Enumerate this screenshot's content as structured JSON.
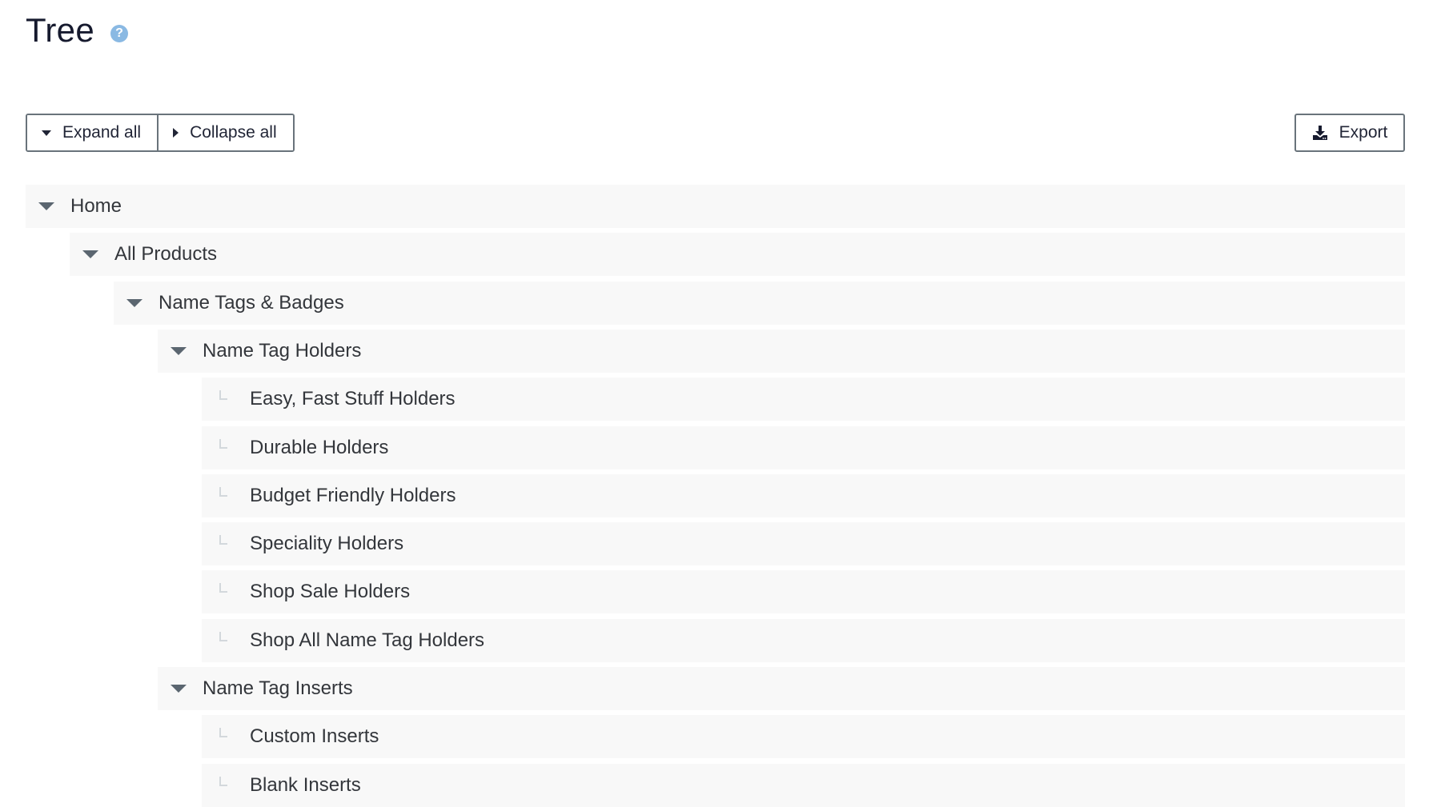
{
  "page": {
    "title": "Tree",
    "help_icon": "question-circle-icon"
  },
  "toolbar": {
    "expand_all_label": "Expand all",
    "collapse_all_label": "Collapse all",
    "export_label": "Export",
    "export_icon": "download-icon"
  },
  "colors": {
    "title": "#161a2e",
    "help_icon": "#8ab9e3",
    "button_border": "#69737b",
    "row_background": "#f8f8f8",
    "toggle": "#5b6670",
    "leaf_marker": "#d3d8dc"
  },
  "tree": [
    {
      "label": "Home",
      "level": 0,
      "type": "branch",
      "expanded": true
    },
    {
      "label": "All Products",
      "level": 1,
      "type": "branch",
      "expanded": true
    },
    {
      "label": "Name Tags & Badges",
      "level": 2,
      "type": "branch",
      "expanded": true
    },
    {
      "label": "Name Tag Holders",
      "level": 3,
      "type": "branch",
      "expanded": true
    },
    {
      "label": "Easy, Fast Stuff Holders",
      "level": 4,
      "type": "leaf"
    },
    {
      "label": "Durable Holders",
      "level": 4,
      "type": "leaf"
    },
    {
      "label": "Budget Friendly Holders",
      "level": 4,
      "type": "leaf"
    },
    {
      "label": "Speciality Holders",
      "level": 4,
      "type": "leaf"
    },
    {
      "label": "Shop Sale Holders",
      "level": 4,
      "type": "leaf"
    },
    {
      "label": "Shop All Name Tag Holders",
      "level": 4,
      "type": "leaf"
    },
    {
      "label": "Name Tag Inserts",
      "level": 3,
      "type": "branch",
      "expanded": true
    },
    {
      "label": "Custom Inserts",
      "level": 4,
      "type": "leaf"
    },
    {
      "label": "Blank Inserts",
      "level": 4,
      "type": "leaf"
    }
  ]
}
